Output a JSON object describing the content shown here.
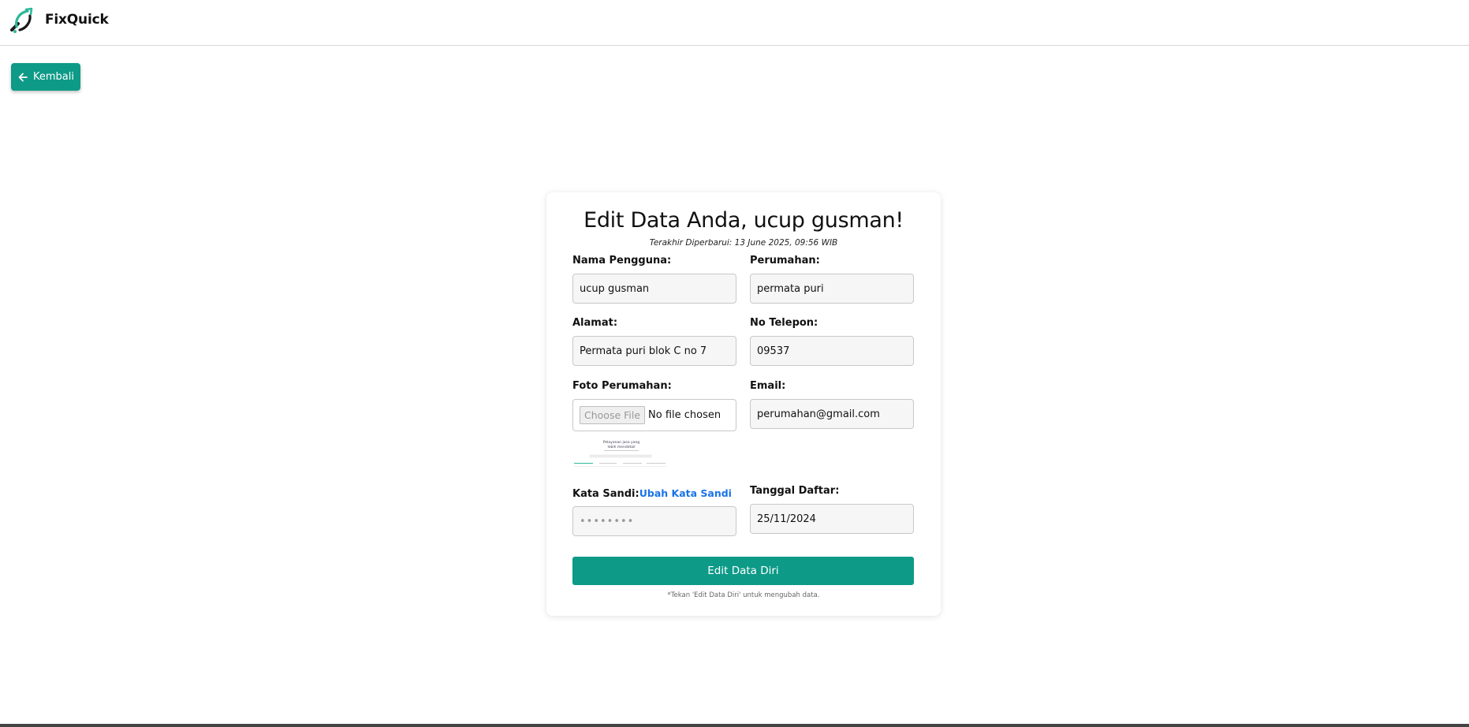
{
  "header": {
    "brand": "FixQuick",
    "logo_icon": "fixquick-logo-icon"
  },
  "back_button": {
    "label": "Kembali",
    "icon": "arrow-left-icon"
  },
  "form": {
    "title": "Edit Data Anda, ucup gusman!",
    "subtitle": "Terakhir Diperbarui: 13 June 2025, 09:56 WIB",
    "fields": {
      "nama_pengguna": {
        "label": "Nama Pengguna:",
        "value": "ucup gusman"
      },
      "perumahan": {
        "label": "Perumahan:",
        "value": "permata puri"
      },
      "alamat": {
        "label": "Alamat:",
        "value": "Permata puri blok C no 7"
      },
      "no_telepon": {
        "label": "No Telepon:",
        "value": "09537"
      },
      "foto_perumahan": {
        "label": "Foto Perumahan:",
        "button": "Choose File",
        "status": "No file chosen"
      },
      "email": {
        "label": "Email:",
        "value": "perumahan@gmail.com"
      },
      "kata_sandi": {
        "label": "Kata Sandi:",
        "link": "Ubah Kata Sandi",
        "value": "••••••••"
      },
      "tanggal_daftar": {
        "label": "Tanggal Daftar:",
        "value": "25/11/2024"
      }
    },
    "thumbnail_text": [
      "Pelayanan jasa yang",
      "lebih mendetail"
    ],
    "submit_label": "Edit Data Diri",
    "note": "*Tekan 'Edit Data Diri' untuk mengubah data."
  },
  "colors": {
    "accent": "#0d9a87",
    "link": "#1a73e8"
  }
}
